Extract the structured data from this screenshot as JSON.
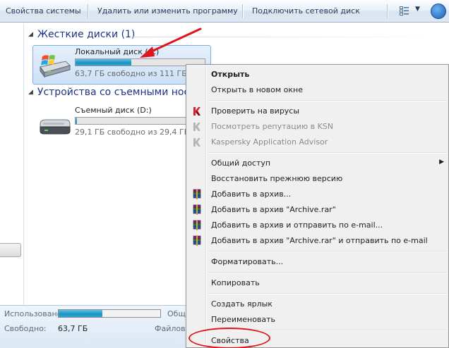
{
  "toolbar": {
    "items": [
      {
        "label": "Свойства системы"
      },
      {
        "label": "Удалить или изменить программу"
      },
      {
        "label": "Подключить сетевой диск"
      }
    ],
    "view_icon": "view-options-icon",
    "help_icon": "help-icon"
  },
  "groups": [
    {
      "title": "Жесткие диски (1)"
    },
    {
      "title": "Устройства со съемными нос"
    }
  ],
  "drives": [
    {
      "name": "Локальный диск (C:)",
      "free_text": "63,7 ГБ свободно из 111 ГБ",
      "used_fraction": 0.43,
      "selected": true,
      "icon": "hard-drive-windows-icon"
    },
    {
      "name": "Съемный диск (D:)",
      "free_text": "29,1 ГБ свободно из 29,4 ГБ",
      "used_fraction": 0.01,
      "selected": false,
      "icon": "removable-drive-icon"
    }
  ],
  "details": {
    "used_label": "Использовано:",
    "free_label": "Свободно:",
    "free_value": "63,7 ГБ",
    "used_fraction": 0.43,
    "col2_label1": "Общ",
    "col2_label2": "Файлова"
  },
  "context_menu": {
    "items": [
      {
        "label": "Открыть",
        "bold": true
      },
      {
        "label": "Открыть в новом окне"
      },
      {
        "label": "Проверить на вирусы",
        "icon": "kaspersky-k-icon"
      },
      {
        "label": "Посмотреть репутацию в KSN",
        "icon": "kaspersky-k-gray-icon",
        "disabled": true
      },
      {
        "label": "Kaspersky Application Advisor",
        "icon": "kaspersky-k-gray-icon",
        "disabled": true
      },
      {
        "label": "Общий доступ",
        "submenu": true
      },
      {
        "label": "Восстановить прежнюю версию"
      },
      {
        "label": "Добавить в архив...",
        "icon": "winrar-icon"
      },
      {
        "label": "Добавить в архив \"Archive.rar\"",
        "icon": "winrar-icon"
      },
      {
        "label": "Добавить в архив и отправить по e-mail...",
        "icon": "winrar-icon"
      },
      {
        "label": "Добавить в архив \"Archive.rar\" и отправить по e-mail",
        "icon": "winrar-icon"
      },
      {
        "label": "Форматировать..."
      },
      {
        "label": "Копировать"
      },
      {
        "label": "Создать ярлык"
      },
      {
        "label": "Переименовать"
      },
      {
        "label": "Свойства"
      }
    ]
  },
  "colors": {
    "annotation": "#e0141c",
    "group_header": "#1e3287",
    "bar_fill": "#1f93c3"
  }
}
